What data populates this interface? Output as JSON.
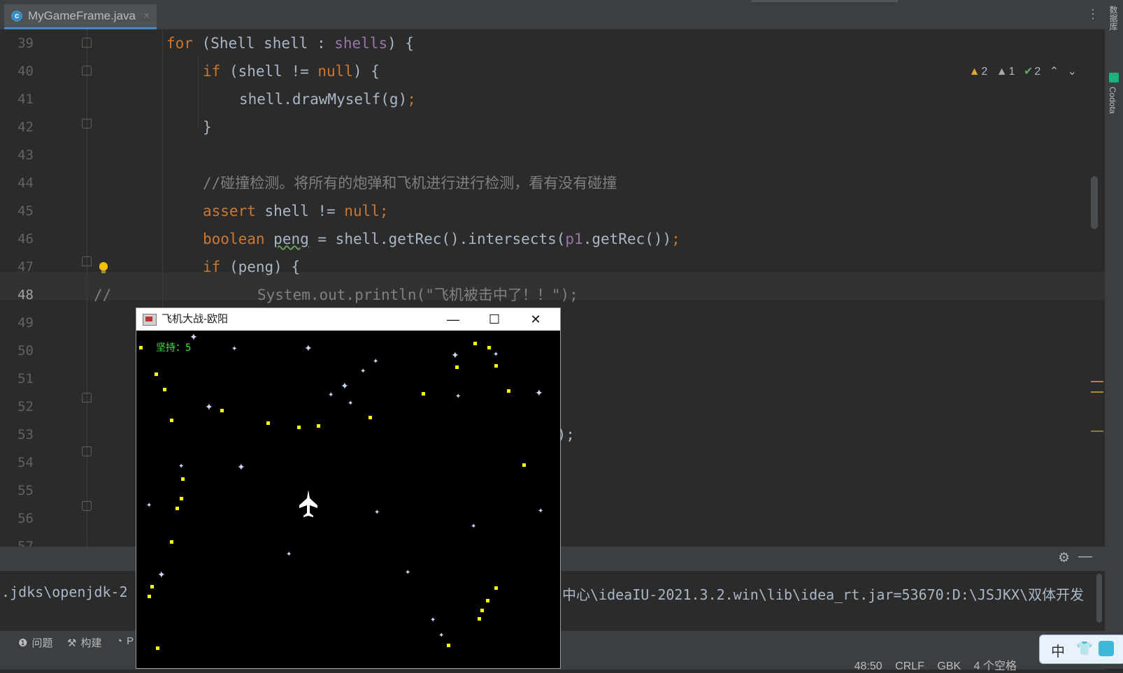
{
  "tab": {
    "filename": "MyGameFrame.java",
    "close": "×",
    "file_icon_letter": "c"
  },
  "inspections": {
    "warnings": "2",
    "weak_warnings": "1",
    "ok": "2"
  },
  "right_strip": {
    "database": "数据库",
    "codota": "Codota"
  },
  "editor": {
    "lines": [
      {
        "no": "39",
        "html_key": "l39"
      },
      {
        "no": "40"
      },
      {
        "no": "41"
      },
      {
        "no": "42"
      },
      {
        "no": "43"
      },
      {
        "no": "44"
      },
      {
        "no": "45"
      },
      {
        "no": "46"
      },
      {
        "no": "47"
      },
      {
        "no": "48"
      },
      {
        "no": "49"
      },
      {
        "no": "50"
      },
      {
        "no": "51"
      },
      {
        "no": "52"
      },
      {
        "no": "53"
      },
      {
        "no": "54"
      },
      {
        "no": "55"
      },
      {
        "no": "56"
      },
      {
        "no": "57"
      }
    ],
    "code": {
      "l39_kw": "for",
      "l39_rest1": " (Shell shell : ",
      "l39_fld": "shells",
      "l39_rest2": ") {",
      "l40_kw": "if",
      "l40_rest1": " (shell != ",
      "l40_null": "null",
      "l40_rest2": ") {",
      "l41_text": "shell.drawMyself(g)",
      "l41_semi": ";",
      "l42_text": "}",
      "l44_comment": "//碰撞检测。将所有的炮弹和飞机进行进行检测，看有没有碰撞",
      "l45_kw": "assert",
      "l45_rest": " shell != ",
      "l45_null": "null;",
      "l46_kw": "boolean",
      "l46_var": "peng",
      "l46_rest1": " = shell.getRec().intersects(",
      "l46_fld": "p1",
      "l46_rest2": ".getRec())",
      "l46_semi": ";",
      "l47_kw": "if",
      "l47_rest": " (peng) {",
      "l48_prefix": "//",
      "l48_text": "System.out.println(\"飞机被击中了！！\");",
      "l53_tail": "y);"
    }
  },
  "console": {
    "left_text": ".jdks\\openjdk-2",
    "right_text": "中心\\ideaIU-2021.3.2.win\\lib\\idea_rt.jar=53670:D:\\JSJKX\\双体开发"
  },
  "toolwindows": {
    "problems": "问题",
    "build": "构建",
    "profiler": "P"
  },
  "status": {
    "position": "48:50",
    "line_sep": "CRLF",
    "encoding": "GBK",
    "indent": "4 个空格"
  },
  "ime": {
    "mode": "中"
  },
  "game_window": {
    "title": "飞机大战-欧阳",
    "minimize": "—",
    "maximize": "☐",
    "close": "✕",
    "hud": "坚持：5"
  }
}
